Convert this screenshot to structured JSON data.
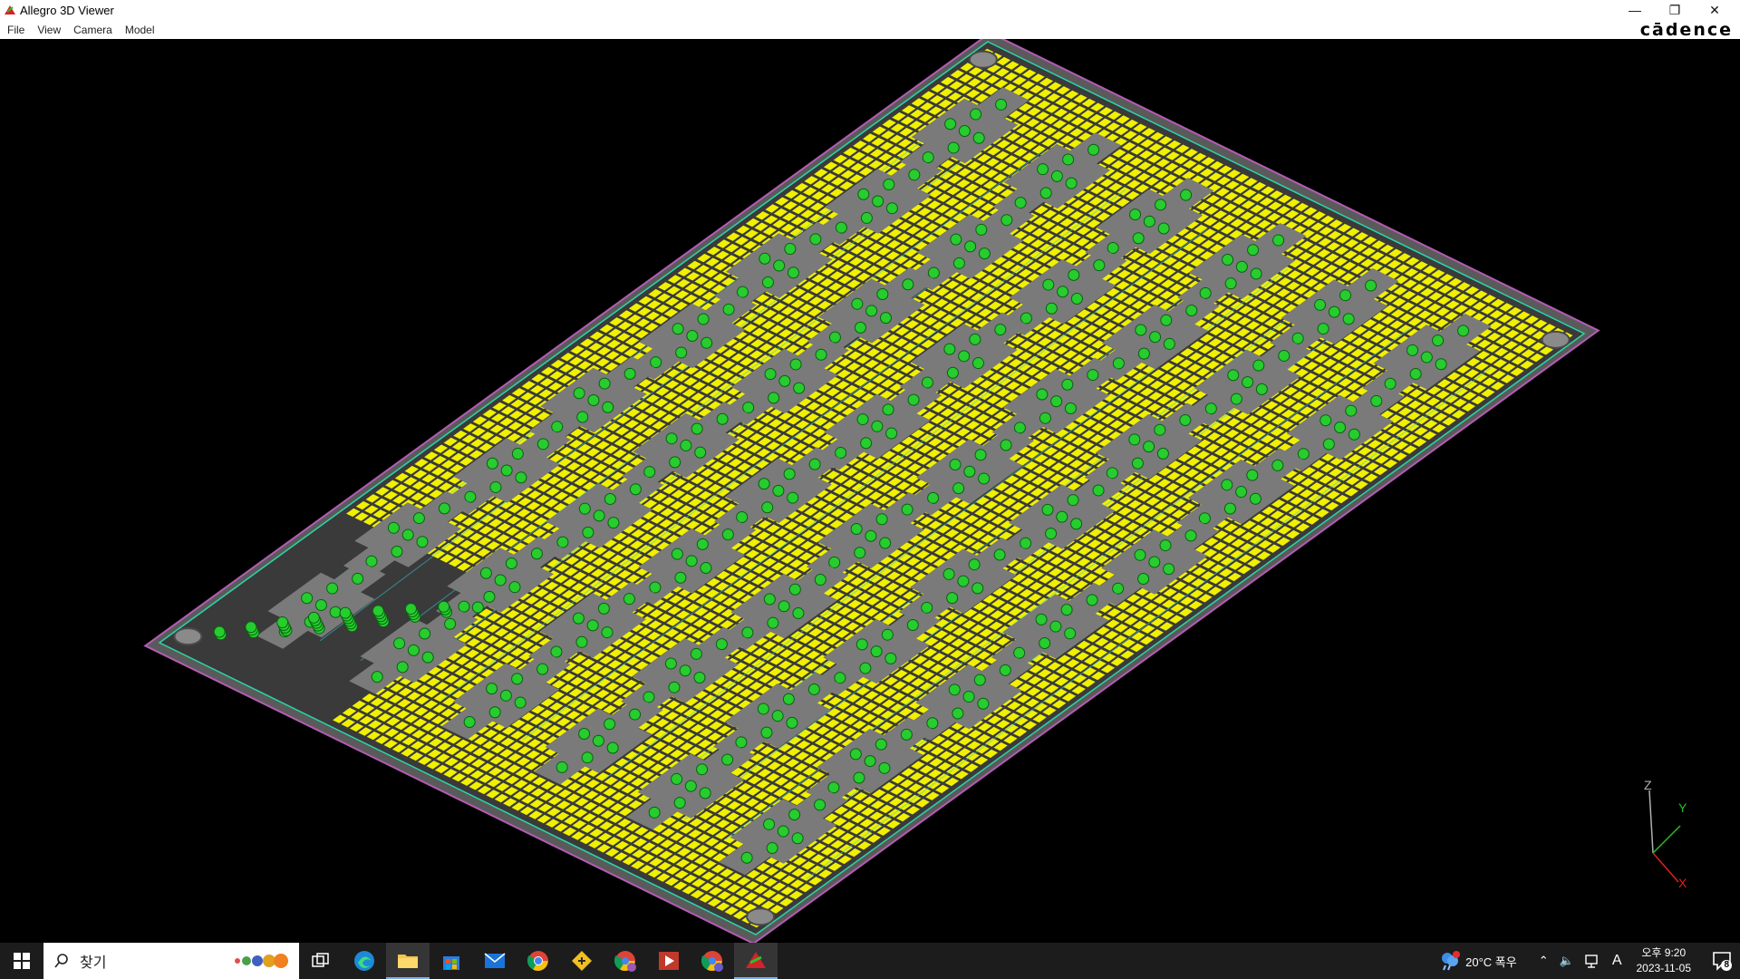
{
  "window": {
    "title": "Allegro 3D Viewer"
  },
  "menu": [
    "File",
    "View",
    "Camera",
    "Model"
  ],
  "brand": "cādence",
  "axes": {
    "z": "Z",
    "y": "Y",
    "x": "X"
  },
  "colors": {
    "copper": "#f0f000",
    "board_edge": "#b45cb4",
    "outline": "#2ad7a8",
    "pad_gray": "#7a7a7a",
    "via_green": "#27cc2f",
    "trace": "#3cc8d8",
    "axis_x": "#e02020",
    "axis_y": "#20c020",
    "axis_z": "#b0b0b0"
  },
  "taskbar": {
    "search_placeholder": "찾기",
    "weather": "20°C  폭우",
    "time": "오후 9:20",
    "date": "2023-11-05",
    "notification_count": "8",
    "ime": "A",
    "icons": [
      "task-view-icon",
      "edge-icon",
      "file-explorer-icon",
      "store-icon",
      "mail-icon",
      "chrome-icon",
      "git-icon",
      "chrome-profile-icon",
      "media-icon",
      "chrome-profile-2-icon",
      "allegro-icon"
    ]
  }
}
